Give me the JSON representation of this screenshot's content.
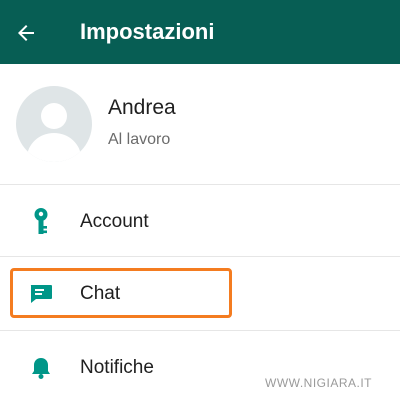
{
  "header": {
    "title": "Impostazioni",
    "back_icon": "arrow-left-icon",
    "background_color": "#075e54"
  },
  "profile": {
    "name": "Andrea",
    "status": "Al lavoro",
    "avatar_icon": "default-avatar-icon"
  },
  "menu": {
    "items": [
      {
        "label": "Account",
        "icon": "key-icon"
      },
      {
        "label": "Chat",
        "icon": "chat-bubble-icon"
      },
      {
        "label": "Notifiche",
        "icon": "bell-icon"
      }
    ],
    "icon_color": "#009688"
  },
  "highlight": {
    "target": "Chat",
    "color": "#f47c20"
  },
  "watermark": "WWW.NIGIARA.IT"
}
